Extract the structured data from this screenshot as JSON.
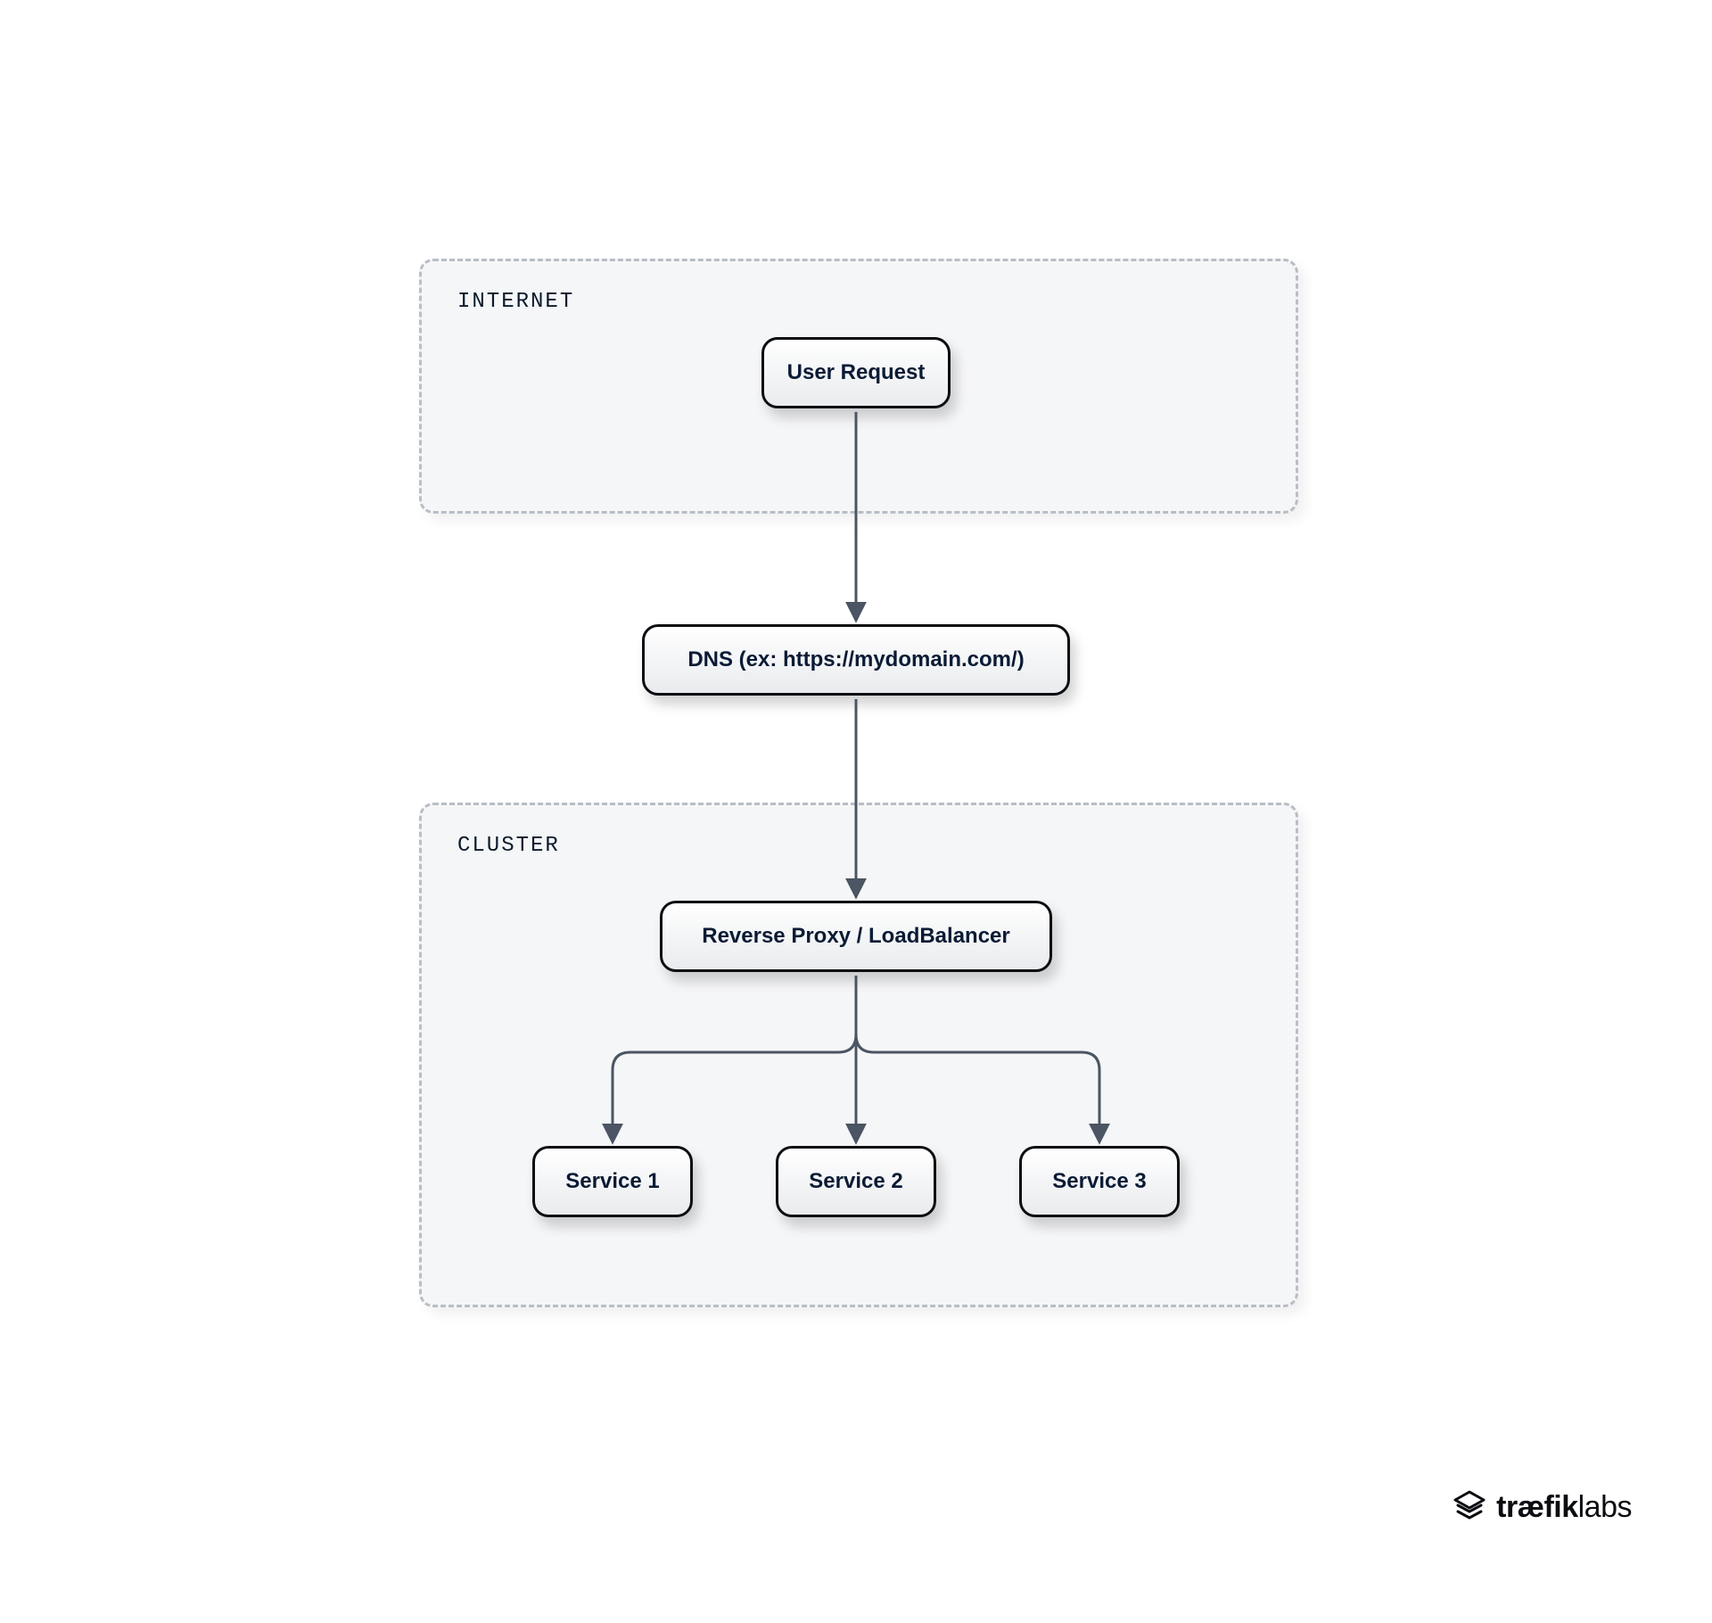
{
  "zones": {
    "internet": {
      "label": "INTERNET"
    },
    "cluster": {
      "label": "CLUSTER"
    }
  },
  "nodes": {
    "user_request": {
      "label": "User Request"
    },
    "dns": {
      "label": "DNS (ex: https://mydomain.com/)"
    },
    "proxy": {
      "label": "Reverse Proxy / LoadBalancer"
    },
    "service1": {
      "label": "Service 1"
    },
    "service2": {
      "label": "Service 2"
    },
    "service3": {
      "label": "Service 3"
    }
  },
  "footer": {
    "brand_bold": "træfik",
    "brand_light": "labs"
  },
  "colors": {
    "zone_bg": "#f5f6f8",
    "zone_border": "#b9bec6",
    "node_border": "#0c0e12",
    "text": "#0b1b35",
    "arrow": "#4b5563"
  }
}
